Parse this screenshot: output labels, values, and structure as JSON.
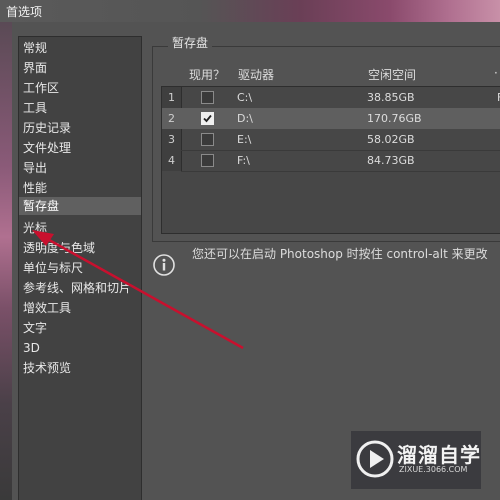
{
  "window": {
    "title": "首选项"
  },
  "sidebar": {
    "items": [
      {
        "label": "常规",
        "selected": false
      },
      {
        "label": "界面",
        "selected": false
      },
      {
        "label": "工作区",
        "selected": false
      },
      {
        "label": "工具",
        "selected": false
      },
      {
        "label": "历史记录",
        "selected": false
      },
      {
        "label": "文件处理",
        "selected": false
      },
      {
        "label": "导出",
        "selected": false
      },
      {
        "label": "性能",
        "selected": false
      },
      {
        "label": "暂存盘",
        "selected": true
      },
      {
        "label": "光标",
        "selected": false
      },
      {
        "label": "透明度与色域",
        "selected": false
      },
      {
        "label": "单位与标尺",
        "selected": false
      },
      {
        "label": "参考线、网格和切片",
        "selected": false
      },
      {
        "label": "增效工具",
        "selected": false
      },
      {
        "label": "文字",
        "selected": false
      },
      {
        "label": "3D",
        "selected": false
      },
      {
        "label": "技术预览",
        "selected": false
      }
    ]
  },
  "scratch_disks": {
    "group_title": "暂存盘",
    "headers": {
      "active": "现用？",
      "drive": "驱动器",
      "free_space": "空闲空间",
      "extra": "·"
    },
    "rows": [
      {
        "num": "1",
        "checked": false,
        "drive": "C:\\",
        "free_space": "38.85GB",
        "extra": "F",
        "selected": false
      },
      {
        "num": "2",
        "checked": true,
        "drive": "D:\\",
        "free_space": "170.76GB",
        "extra": "",
        "selected": true
      },
      {
        "num": "3",
        "checked": false,
        "drive": "E:\\",
        "free_space": "58.02GB",
        "extra": "",
        "selected": false
      },
      {
        "num": "4",
        "checked": false,
        "drive": "F:\\",
        "free_space": "84.73GB",
        "extra": "",
        "selected": false
      }
    ]
  },
  "info": {
    "text": "您还可以在启动 Photoshop 时按住 control-alt 来更改"
  },
  "watermark": {
    "brand": "溜溜自学",
    "url": "ZIXUE.3066.COM"
  },
  "colors": {
    "annotation_arrow": "#c8102e",
    "selected_row": "#5f5f5f",
    "panel_bg": "#535353"
  }
}
